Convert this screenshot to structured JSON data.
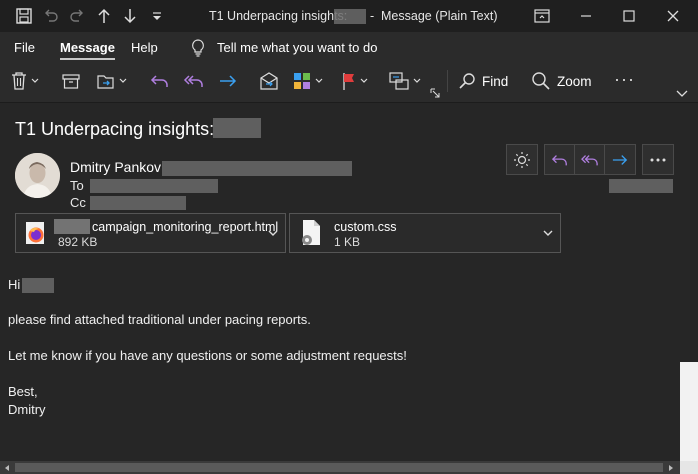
{
  "window": {
    "title_prefix": "T1 Underpacing insights:",
    "title_separator": "-",
    "title_suffix": "Message (Plain Text)"
  },
  "menu": {
    "file": "File",
    "message": "Message",
    "help": "Help",
    "tell_me": "Tell me what you want to do"
  },
  "ribbon": {
    "find": "Find",
    "zoom": "Zoom",
    "more": "···"
  },
  "message": {
    "subject": "T1 Underpacing insights:",
    "sender_name": "Dmitry Pankov",
    "to_label": "To",
    "cc_label": "Cc"
  },
  "attachments": [
    {
      "name": "campaign_monitoring_report.html",
      "size": "892 KB",
      "icon": "firefox-html-icon"
    },
    {
      "name": "custom.css",
      "size": "1 KB",
      "icon": "css-file-icon"
    }
  ],
  "body": {
    "greeting": "Hi",
    "line1": "please find attached traditional under pacing reports.",
    "line2": "Let me know if you have any questions or some adjustment requests!",
    "closing": "Best,",
    "signature": "Dmitry"
  },
  "colors": {
    "background": "#262626",
    "reply_purple": "#b07fe0",
    "forward_blue": "#3aa0f0",
    "flag_red": "#e03c3c"
  }
}
